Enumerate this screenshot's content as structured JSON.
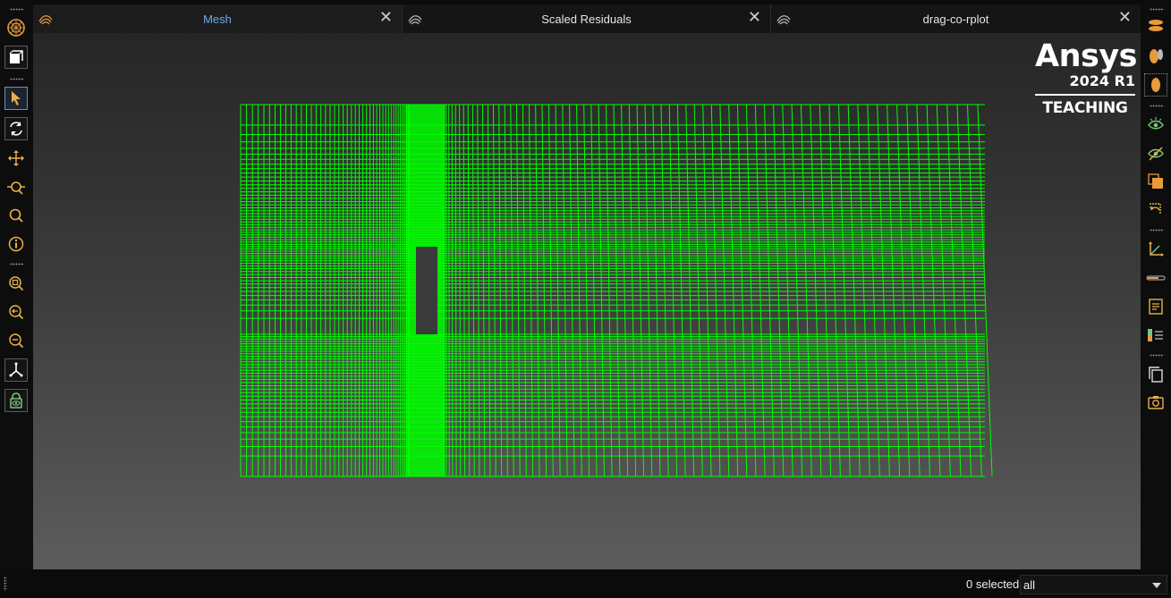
{
  "tabs": [
    {
      "label": "Mesh",
      "active": true
    },
    {
      "label": "Scaled Residuals",
      "active": false
    },
    {
      "label": "drag-co-rplot",
      "active": false
    }
  ],
  "tab_close_glyph": "✕",
  "logo": {
    "name": "Ansys",
    "version": "2024 R1",
    "edition": "TEACHING"
  },
  "status": {
    "selected_count": "0 selected",
    "filter_value": "all"
  },
  "colors": {
    "mesh": "#00ff00",
    "accent": "#e89a3c",
    "active_tab_text": "#6fa9ee",
    "obstacle": "#3a3a3a"
  },
  "left_toolbar": [
    "mesh-display-icon",
    "view-cube-icon",
    "select-pointer-icon",
    "rotate-icon",
    "pan-icon",
    "zoom-dynamic-icon",
    "zoom-icon",
    "probe-info-icon",
    "zoom-fit-icon",
    "zoom-in-icon",
    "zoom-out-icon",
    "axes-triad-icon",
    "lock-view-icon"
  ],
  "right_toolbar": [
    "plane-top-icon",
    "plane-side-icon",
    "plane-front-icon",
    "show-eye-icon",
    "hide-eye-icon",
    "transparency-icon",
    "reset-view-icon",
    "axes-icon",
    "slider-icon",
    "annotation-icon",
    "legend-icon",
    "copy-icon",
    "screenshot-icon"
  ]
}
